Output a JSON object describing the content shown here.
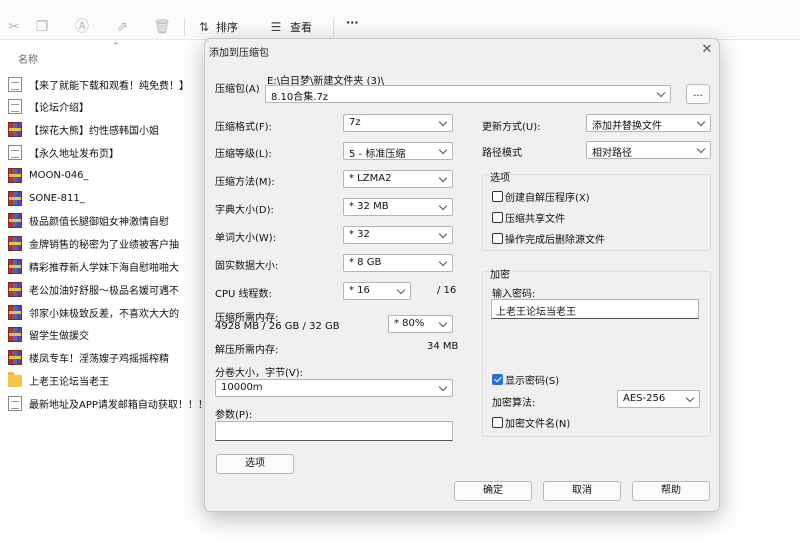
{
  "toolbar": {
    "sort_label": "排序",
    "view_label": "查看",
    "more_label": "···"
  },
  "file_list": {
    "column_name": "名称",
    "items": [
      {
        "name": "【来了就能下载和观看！纯免费！】",
        "icon": "doc"
      },
      {
        "name": "【论坛介绍】",
        "icon": "doc"
      },
      {
        "name": "【探花大熊】约性感韩国小姐",
        "icon": "rar"
      },
      {
        "name": "【永久地址发布页】",
        "icon": "doc"
      },
      {
        "name": "MOON-046_",
        "icon": "rar"
      },
      {
        "name": "SONE-811_",
        "icon": "rar"
      },
      {
        "name": "极品颜值长腿御姐女神激情自慰",
        "icon": "rar"
      },
      {
        "name": "金牌销售的秘密为了业绩被客户抽",
        "icon": "rar"
      },
      {
        "name": "精彩推荐新人学妹下海自慰啪啪大",
        "icon": "rar"
      },
      {
        "name": "老公加油好舒服～极品名媛可遇不",
        "icon": "rar"
      },
      {
        "name": "邻家小妹极致反差，不喜欢大大的",
        "icon": "rar"
      },
      {
        "name": "留学生做援交",
        "icon": "rar"
      },
      {
        "name": "楼凤专车！淫荡嫂子鸡摇摇榨精",
        "icon": "rar"
      },
      {
        "name": "上老王论坛当老王",
        "icon": "folder"
      },
      {
        "name": "最新地址及APP请发邮箱自动获取！！！",
        "icon": "doc"
      }
    ]
  },
  "dialog": {
    "title": "添加到压缩包",
    "archive_label": "压缩包(A)",
    "archive_path": "E:\\白日梦\\新建文件夹 (3)\\",
    "archive_name": "8.10合集.7z",
    "browse_label": "...",
    "format_label": "压缩格式(F):",
    "format_value": "7z",
    "level_label": "压缩等级(L):",
    "level_value": "5 - 标准压缩",
    "method_label": "压缩方法(M):",
    "method_value": "* LZMA2",
    "dict_label": "字典大小(D):",
    "dict_value": "* 32 MB",
    "word_label": "单词大小(W):",
    "word_value": "* 32",
    "solid_label": "固实数据大小:",
    "solid_value": "* 8 GB",
    "cpu_label": "CPU 线程数:",
    "cpu_value": "* 16",
    "cpu_total": "/ 16",
    "mem_label": "压缩所需内存:",
    "mem_detail": "4928 MB / 26 GB / 32 GB",
    "mem_value": "* 80%",
    "decomp_label": "解压所需内存:",
    "decomp_value": "34 MB",
    "split_label": "分卷大小，字节(V):",
    "split_value": "10000m",
    "params_label": "参数(P):",
    "params_value": "",
    "options_button": "选项",
    "update_label": "更新方式(U):",
    "update_value": "添加并替换文件",
    "path_label": "路径模式",
    "path_value": "相对路径",
    "options_group": "选项",
    "opt_sfx": "创建自解压程序(X)",
    "opt_shared": "压缩共享文件",
    "opt_delete": "操作完成后删除源文件",
    "encrypt_group": "加密",
    "password_label": "输入密码:",
    "password_value": "上老王论坛当老王",
    "show_password": "显示密码(S)",
    "enc_method_label": "加密算法:",
    "enc_method_value": "AES-256",
    "encrypt_names": "加密文件名(N)",
    "ok_button": "确定",
    "cancel_button": "取消",
    "help_button": "帮助"
  },
  "state": {
    "opt_sfx_checked": false,
    "opt_shared_checked": false,
    "opt_delete_checked": false,
    "show_password_checked": true,
    "encrypt_names_checked": false
  }
}
